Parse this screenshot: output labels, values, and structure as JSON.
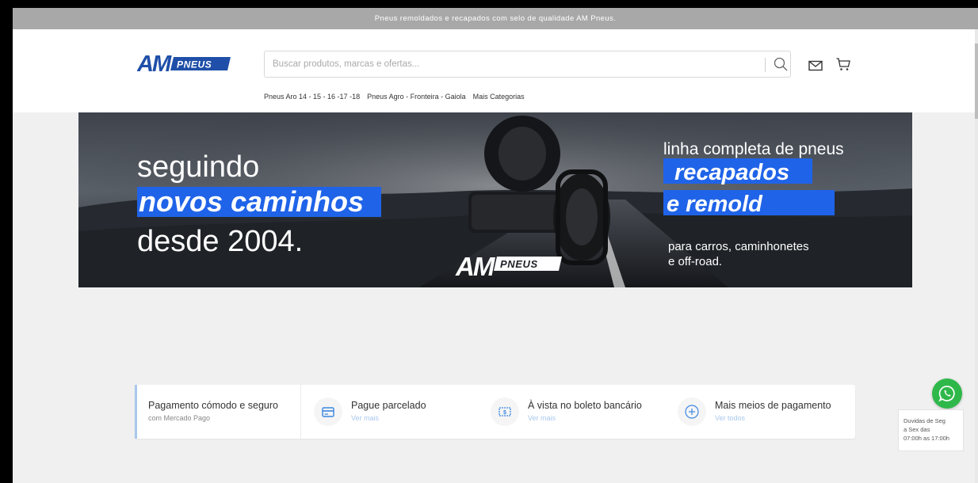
{
  "topbar": {
    "message": "Pneus remoldados e recapados com selo de qualidade AM Pneus."
  },
  "header": {
    "logo_text": "AMPNEUS",
    "search": {
      "placeholder": "Buscar produtos, marcas e ofertas...",
      "value": ""
    },
    "icons": {
      "search": "search-icon",
      "mail": "mail-icon",
      "cart": "cart-icon"
    }
  },
  "nav": {
    "items": [
      {
        "label": "Pneus Aro 14 - 15 - 16 -17 -18"
      },
      {
        "label": "Pneus Agro - Fronteira - Gaiola"
      },
      {
        "label": "Mais Categorias"
      }
    ]
  },
  "banner": {
    "left_line1": "seguindo",
    "left_line2": "novos caminhos",
    "left_line3": "desde 2004.",
    "right_line1": "linha completa de pneus",
    "right_line2": "recapados",
    "right_line3": "e remold",
    "right_line4": "para carros, caminhonetes",
    "right_line5": "e off-road.",
    "logo_text": "AMPNEUS",
    "accent_color": "#1f63e8"
  },
  "payments": {
    "first": {
      "title": "Pagamento cómodo e seguro",
      "subtitle": "com Mercado Pago"
    },
    "items": [
      {
        "title": "Pague parcelado",
        "link": "Ver mais",
        "icon": "card-icon"
      },
      {
        "title": "À vista no boleto bancário",
        "link": "Ver mais",
        "icon": "cash-icon"
      },
      {
        "title": "Mais meios de pagamento",
        "link": "Ver todos",
        "icon": "plus-circle-icon"
      }
    ]
  },
  "support": {
    "line1": "Duvidas de Seg",
    "line2": "a Sex das",
    "line3": "07:00h as 17:00h",
    "whatsapp_color": "#2fb84a"
  }
}
